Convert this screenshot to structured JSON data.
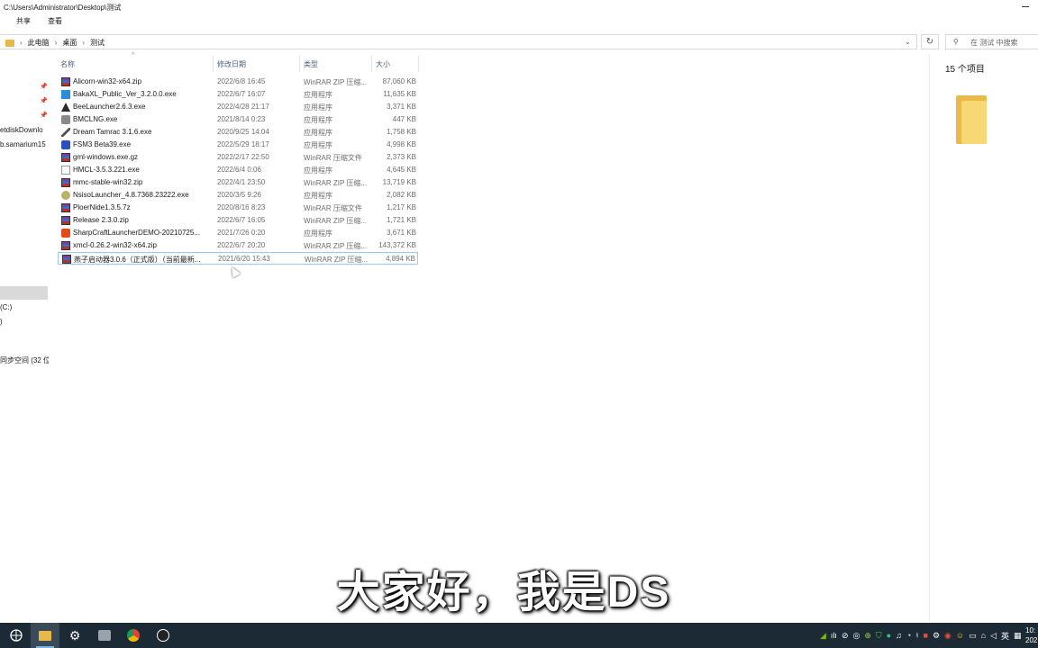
{
  "window": {
    "path": "C:\\Users\\Administrator\\Desktop\\测试",
    "ribbon_tabs": [
      "共享",
      "查看"
    ]
  },
  "address": {
    "crumbs": [
      "此电脑",
      "桌面",
      "测试"
    ],
    "search_placeholder": "在 测试 中搜索"
  },
  "nav": {
    "items": [
      "etdiskDownlo",
      "b.samarium15",
      "(C:)",
      ")",
      "同步空间 (32 位"
    ]
  },
  "columns": {
    "name": "名称",
    "date": "修改日期",
    "type": "类型",
    "size": "大小"
  },
  "files": [
    {
      "name": "Alicorn-win32-x64.zip",
      "date": "2022/6/8 16:45",
      "type": "WinRAR ZIP 压缩...",
      "size": "87,060 KB",
      "icon": "winrar-icon"
    },
    {
      "name": "BakaXL_Public_Ver_3.2.0.0.exe",
      "date": "2022/6/7 16:07",
      "type": "应用程序",
      "size": "11,635 KB",
      "icon": "bakaxl-icon"
    },
    {
      "name": "BeeLauncher2.6.3.exe",
      "date": "2022/4/28 21:17",
      "type": "应用程序",
      "size": "3,371 KB",
      "icon": "bee-icon"
    },
    {
      "name": "BMCLNG.exe",
      "date": "2021/8/14 0:23",
      "type": "应用程序",
      "size": "447 KB",
      "icon": "bmcl-icon"
    },
    {
      "name": "Dream Tamrac 3.1.6.exe",
      "date": "2020/9/25 14:04",
      "type": "应用程序",
      "size": "1,758 KB",
      "icon": "pickaxe-icon"
    },
    {
      "name": "FSM3 Beta39.exe",
      "date": "2022/5/29 18:17",
      "type": "应用程序",
      "size": "4,998 KB",
      "icon": "fsm-icon"
    },
    {
      "name": "gml-windows.exe.gz",
      "date": "2022/2/17 22:50",
      "type": "WinRAR 压缩文件",
      "size": "2,373 KB",
      "icon": "winrar-icon"
    },
    {
      "name": "HMCL-3.5.3.221.exe",
      "date": "2022/6/4 0:06",
      "type": "应用程序",
      "size": "4,645 KB",
      "icon": "file-icon"
    },
    {
      "name": "mmc-stable-win32.zip",
      "date": "2022/4/1 23:50",
      "type": "WinRAR ZIP 压缩...",
      "size": "13,719 KB",
      "icon": "winrar-icon"
    },
    {
      "name": "NsisoLauncher_4.8.7368.23222.exe",
      "date": "2020/3/5 9:26",
      "type": "应用程序",
      "size": "2,082 KB",
      "icon": "nsiso-icon"
    },
    {
      "name": "PloerNide1.3.5.7z",
      "date": "2020/8/16 8:23",
      "type": "WinRAR 压缩文件",
      "size": "1,217 KB",
      "icon": "winrar-icon"
    },
    {
      "name": "Release 2.3.0.zip",
      "date": "2022/6/7 16:05",
      "type": "WinRAR ZIP 压缩...",
      "size": "1,721 KB",
      "icon": "winrar-icon"
    },
    {
      "name": "SharpCraftLauncherDEMO-20210725...",
      "date": "2021/7/26 0:20",
      "type": "应用程序",
      "size": "3,671 KB",
      "icon": "sharpcraft-icon"
    },
    {
      "name": "xmcl-0.26.2-win32-x64.zip",
      "date": "2022/6/7 20:20",
      "type": "WinRAR ZIP 压缩...",
      "size": "143,372 KB",
      "icon": "winrar-icon"
    },
    {
      "name": "燕子启动器3.0.6（正式版）（当前最新...",
      "date": "2021/6/20 15:43",
      "type": "WinRAR ZIP 压缩...",
      "size": "4,894 KB",
      "icon": "winrar-icon"
    }
  ],
  "details": {
    "count": "15 个项目"
  },
  "subtitle": "大家好，我是DS",
  "taskbar": {
    "ime": "英",
    "clock_time": "10:",
    "clock_date": "202"
  }
}
